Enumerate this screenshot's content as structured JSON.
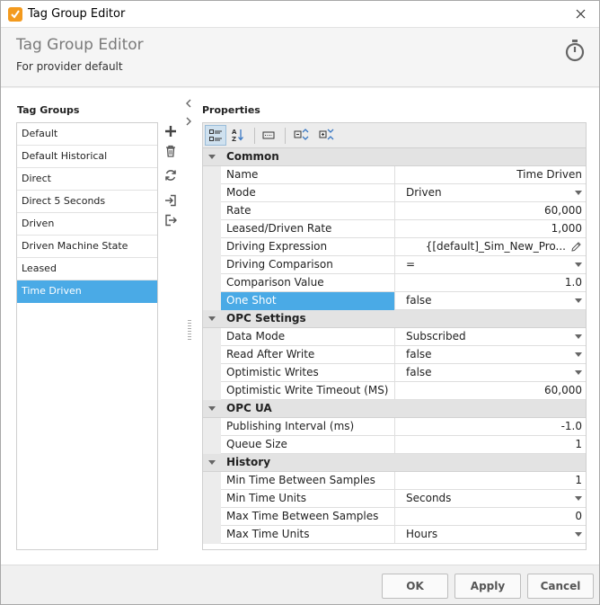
{
  "window": {
    "title": "Tag Group Editor"
  },
  "header": {
    "title": "Tag Group Editor",
    "subtitle": "For provider default"
  },
  "tag_groups": {
    "label": "Tag Groups",
    "items": [
      {
        "label": "Default",
        "selected": false
      },
      {
        "label": "Default Historical",
        "selected": false
      },
      {
        "label": "Direct",
        "selected": false
      },
      {
        "label": "Direct 5 Seconds",
        "selected": false
      },
      {
        "label": "Driven",
        "selected": false
      },
      {
        "label": "Driven Machine State",
        "selected": false
      },
      {
        "label": "Leased",
        "selected": false
      },
      {
        "label": "Time Driven",
        "selected": true
      }
    ]
  },
  "side_tools": [
    "add-icon",
    "delete-icon",
    "refresh-icon",
    "import-icon",
    "export-icon"
  ],
  "properties": {
    "label": "Properties",
    "toolbar": [
      "categorized-icon",
      "sort-alpha-icon",
      "edit-value-icon",
      "expand-all-icon",
      "collapse-all-icon"
    ],
    "categories": [
      {
        "name": "Common",
        "rows": [
          {
            "name": "Name",
            "value": "Time Driven",
            "kind": "text"
          },
          {
            "name": "Mode",
            "value": "Driven",
            "kind": "dropdown"
          },
          {
            "name": "Rate",
            "value": "60,000",
            "kind": "number"
          },
          {
            "name": "Leased/Driven Rate",
            "value": "1,000",
            "kind": "number"
          },
          {
            "name": "Driving Expression",
            "value": "{[default]_Sim_New_Pro...",
            "kind": "expression"
          },
          {
            "name": "Driving Comparison",
            "value": "=",
            "kind": "dropdown"
          },
          {
            "name": "Comparison Value",
            "value": "1.0",
            "kind": "number"
          },
          {
            "name": "One Shot",
            "value": "false",
            "kind": "dropdown",
            "highlight": true
          }
        ]
      },
      {
        "name": "OPC Settings",
        "rows": [
          {
            "name": "Data Mode",
            "value": "Subscribed",
            "kind": "dropdown"
          },
          {
            "name": "Read After Write",
            "value": "false",
            "kind": "dropdown"
          },
          {
            "name": "Optimistic Writes",
            "value": "false",
            "kind": "dropdown"
          },
          {
            "name": "Optimistic Write Timeout (MS)",
            "value": "60,000",
            "kind": "number"
          }
        ]
      },
      {
        "name": "OPC UA",
        "rows": [
          {
            "name": "Publishing Interval (ms)",
            "value": "-1.0",
            "kind": "number"
          },
          {
            "name": "Queue Size",
            "value": "1",
            "kind": "number"
          }
        ]
      },
      {
        "name": "History",
        "rows": [
          {
            "name": "Min Time Between Samples",
            "value": "1",
            "kind": "number"
          },
          {
            "name": "Min Time Units",
            "value": "Seconds",
            "kind": "dropdown"
          },
          {
            "name": "Max Time Between Samples",
            "value": "0",
            "kind": "number"
          },
          {
            "name": "Max Time Units",
            "value": "Hours",
            "kind": "dropdown"
          }
        ]
      }
    ]
  },
  "footer": {
    "ok_label": "OK",
    "apply_label": "Apply",
    "cancel_label": "Cancel"
  },
  "colors": {
    "accent": "#4aaae6",
    "app_icon": "#f39a1e"
  }
}
